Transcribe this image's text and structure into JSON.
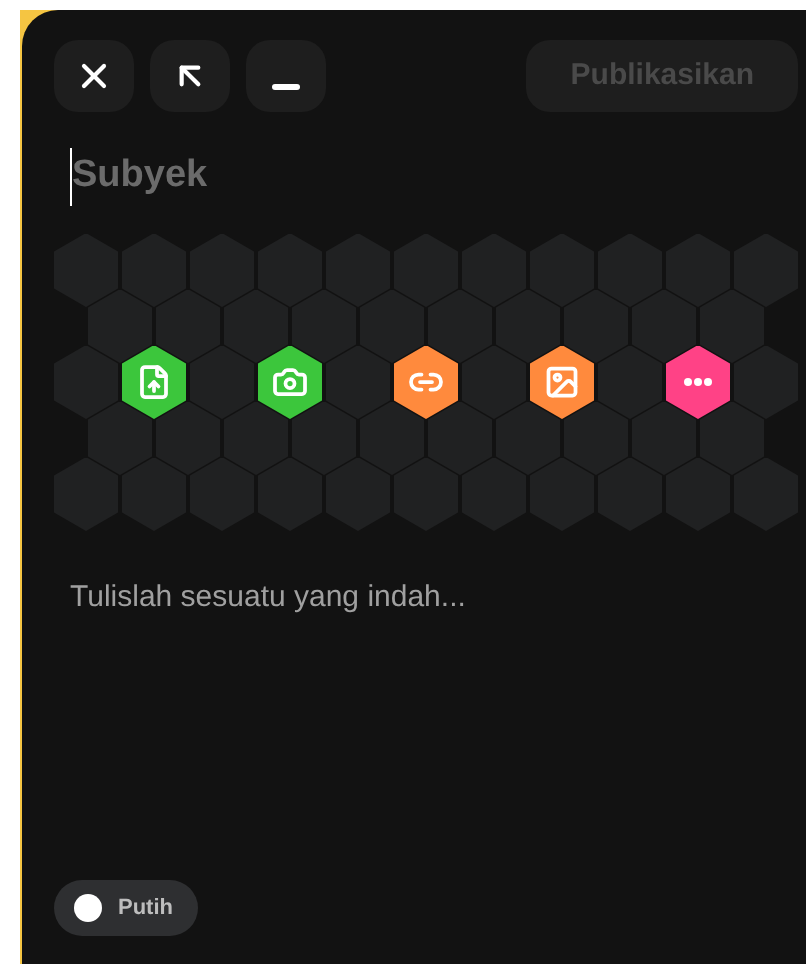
{
  "toolbar": {
    "buttons": [
      {
        "kind": "close"
      },
      {
        "kind": "expand"
      },
      {
        "kind": "minimize"
      }
    ]
  },
  "publish_button": {
    "label": "Publikasikan",
    "disabled": true
  },
  "subject": {
    "placeholder": "Subyek"
  },
  "attachments": [
    {
      "kind": "file",
      "color": "#3cc63c"
    },
    {
      "kind": "camera",
      "color": "#3cc63c"
    },
    {
      "kind": "link",
      "color": "#ff8a3d"
    },
    {
      "kind": "image",
      "color": "#ff8a3d"
    },
    {
      "kind": "more",
      "color": "#ff4286"
    }
  ],
  "body": {
    "placeholder": "Tulislah sesuatu yang indah..."
  },
  "theme_toggle": {
    "label": "Putih"
  }
}
